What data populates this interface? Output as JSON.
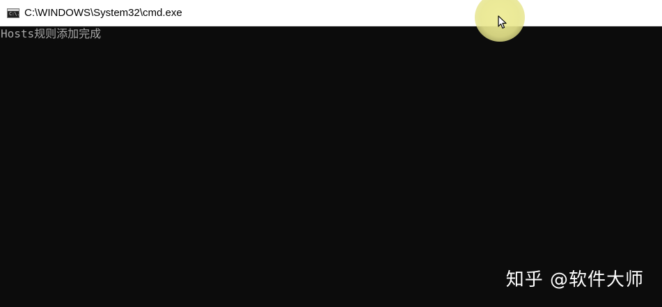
{
  "window": {
    "title": "C:\\WINDOWS\\System32\\cmd.exe",
    "icon": "cmd-console-icon",
    "icon_glyph": "C:\\."
  },
  "console": {
    "lines": [
      "Hosts规则添加完成"
    ]
  },
  "watermark": {
    "text": "知乎 @软件大师"
  },
  "colors": {
    "titlebar_bg": "#ffffff",
    "console_bg": "#0c0c0c",
    "console_text": "#a8a8a8",
    "cursor_highlight": "#eeec96"
  }
}
